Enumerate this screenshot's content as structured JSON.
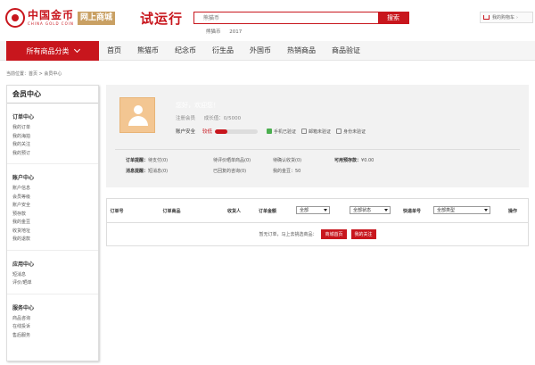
{
  "header": {
    "logo_cn": "中国金币",
    "logo_en": "CHINA GOLD COIN",
    "logo_badge": "网上商城",
    "trial": "试运行",
    "search_placeholder": "熊猫币",
    "search_button": "搜索",
    "hot_words": [
      "熊猫币",
      "2017"
    ],
    "cart_label": "我的购物车"
  },
  "nav": {
    "all_label": "所有商品分类",
    "items": [
      "首页",
      "熊猫币",
      "纪念币",
      "衍生品",
      "外国币",
      "热销商品",
      "商品验证"
    ]
  },
  "breadcrumb": "当前位置：首页 > 会员中心",
  "sidebar": {
    "title": "会员中心",
    "groups": [
      {
        "head": "订单中心",
        "links": [
          "我的订单",
          "我的海拍",
          "我的关注",
          "我的预订"
        ]
      },
      {
        "head": "账户中心",
        "links": [
          "账户信息",
          "会员等级",
          "账户安全",
          "预存款",
          "我的金豆",
          "收货地址",
          "我的退款"
        ]
      },
      {
        "head": "应用中心",
        "links": [
          "短消息",
          "评价/晒单"
        ]
      },
      {
        "head": "服务中心",
        "links": [
          "商品咨询",
          "在线投诉",
          "售后服务"
        ]
      }
    ]
  },
  "member": {
    "welcome": "您好，欢迎您！",
    "level_label": "注册会员",
    "growth_label": "成长值：0/5000",
    "security_label": "账户安全",
    "security_level": "较低",
    "security_percent": 30,
    "verify": [
      "手机已验证",
      "邮箱未验证",
      "身份未验证"
    ],
    "stats": {
      "order_tip": "订单提醒：",
      "pending_pay": "待支付(0)",
      "pending_review": "待评价晒单商品(0)",
      "pending_confirm": "待确认收货(0)",
      "deposit_label": "可用预存款：",
      "deposit_value": "¥0.00",
      "message_tip": "消息提醒：",
      "short_msg": "短消息(0)",
      "reply": "已回复的咨询(0)",
      "beans": "我的金豆：50"
    }
  },
  "table": {
    "headers": [
      "订单号",
      "订单商品",
      "收货人",
      "订单金额",
      "快递单号",
      "操作"
    ],
    "select_time": "全部",
    "select_status": "全部状态",
    "select_type": "全部类型",
    "empty_text": "暂无订单，马上去挑选商品：",
    "btn_shop": "商城首页",
    "btn_follow": "我的关注"
  },
  "colors": {
    "brand": "#c8161d",
    "gold": "#c9a063"
  }
}
